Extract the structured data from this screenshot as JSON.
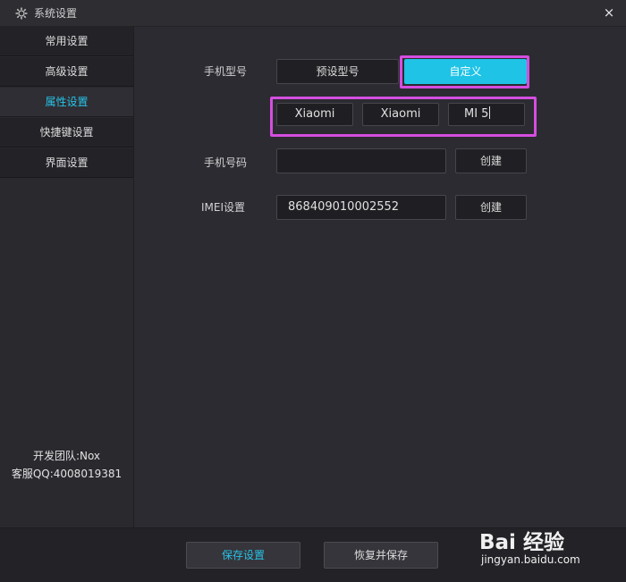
{
  "window": {
    "title": "系统设置",
    "close_icon": "×"
  },
  "sidebar": {
    "items": [
      {
        "label": "常用设置"
      },
      {
        "label": "高级设置"
      },
      {
        "label": "属性设置",
        "active": true
      },
      {
        "label": "快捷键设置"
      },
      {
        "label": "界面设置"
      }
    ],
    "dev_team": "开发团队:Nox",
    "support_qq": "客服QQ:4008019381"
  },
  "phone_model": {
    "label": "手机型号",
    "options": [
      "预设型号",
      "自定义"
    ],
    "selected": "自定义",
    "fields": [
      "Xiaomi",
      "Xiaomi",
      "MI 5"
    ]
  },
  "phone_number": {
    "label": "手机号码",
    "value": "",
    "button": "创建"
  },
  "imei": {
    "label": "IMEI设置",
    "value": "868409010002552",
    "button": "创建"
  },
  "footer": {
    "save": "保存设置",
    "restore_save": "恢复并保存"
  },
  "watermark": {
    "logo_text": "Bai 经验",
    "url": "jingyan.baidu.com"
  },
  "colors": {
    "accent": "#1ec3e6",
    "highlight": "#d54ee0"
  }
}
